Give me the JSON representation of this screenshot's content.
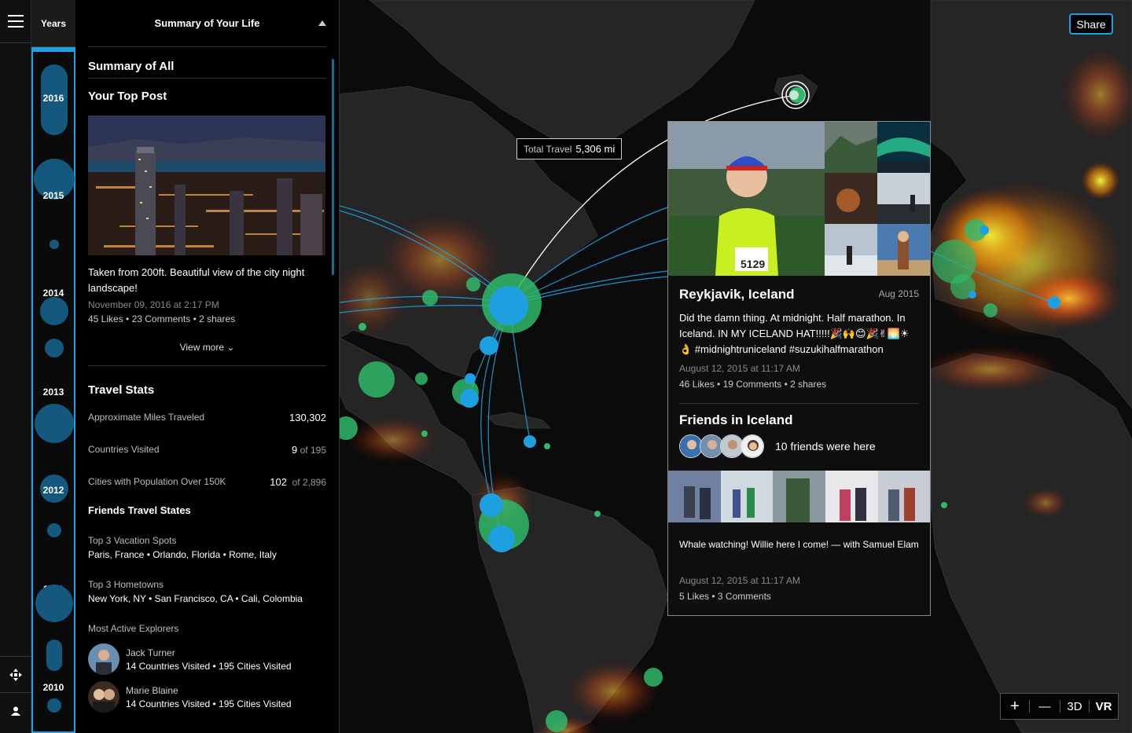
{
  "years_header": "Years",
  "years": [
    "2016",
    "2015",
    "2014",
    "2013",
    "2012",
    "2011",
    "2010"
  ],
  "panel": {
    "title": "Summary of Your Life",
    "summary_all": "Summary of All",
    "top_post_heading": "Your Top Post",
    "post_caption": "Taken from 200ft. Beautiful view of the city night landscape!",
    "post_date": "November 09, 2016 at 2:17 PM",
    "post_stats": "45 Likes • 23 Comments • 2 shares",
    "view_more": "View more",
    "travel_stats_heading": "Travel Stats",
    "stats": [
      {
        "label": "Approximate Miles Traveled",
        "value": "130,302",
        "suffix": ""
      },
      {
        "label": "Countries Visited",
        "value": "9",
        "suffix": "of 195"
      },
      {
        "label": "Cities with Population Over 150K",
        "value": "102",
        "suffix": "of 2,896"
      }
    ],
    "friends_heading": "Friends Travel States",
    "vacation_label": "Top 3 Vacation Spots",
    "vacation_value": "Paris, France  •  Orlando, Florida  •  Rome, Italy",
    "hometowns_label": "Top 3 Hometowns",
    "hometowns_value": "New York, NY  •  San Francisco, CA  • Cali, Colombia",
    "explorers_label": "Most Active Explorers",
    "explorers": [
      {
        "name": "Jack Turner",
        "sub": "14 Countries Visited • 195 Cities Visited"
      },
      {
        "name": "Marie Blaine",
        "sub": "14 Countries Visited • 195 Cities Visited"
      }
    ]
  },
  "share_label": "Share",
  "travel": {
    "label": "Total Travel",
    "value": "5,306 mi"
  },
  "card": {
    "place": "Reykjavik, Iceland",
    "date": "Aug 2015",
    "text": "Did the damn thing. At midnight. Half marathon. In Iceland. IN MY ICELAND HAT!!!!!🎉🙌😊🎉✌🌅☀👌 #midnightruniceland #suzukihalfmarathon",
    "time": "August 12, 2015 at 11:17 AM",
    "stats": "46 Likes • 19 Comments •  2 shares",
    "friends_heading": "Friends in Iceland",
    "friends_text": "10 friends were here",
    "strip_caption": "Whale watching! Willie here I come! — with Samuel Elam",
    "strip_time": "August 12, 2015 at 11:17 AM",
    "strip_stats": "5 Likes • 3 Comments"
  },
  "zoom": {
    "plus": "+",
    "minus": "—",
    "threed": "3D",
    "vr": "VR"
  },
  "colors": {
    "accent": "#1ea0e0",
    "green": "#2fb86a",
    "bubble": "#15587e"
  }
}
